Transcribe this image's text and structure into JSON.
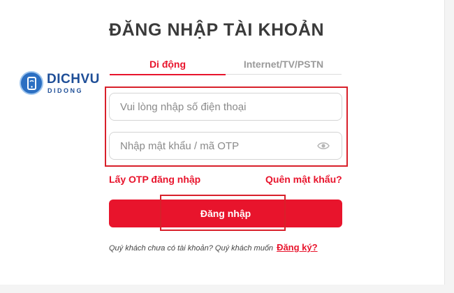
{
  "brand": {
    "logo_word": "DICHVU",
    "logo_sub": "DIDONG",
    "primary_color": "#e8142c",
    "logo_color": "#1e4e97"
  },
  "page": {
    "title": "ĐĂNG NHẬP TÀI KHOẢN"
  },
  "tabs": [
    {
      "label": "Di động",
      "active": true
    },
    {
      "label": "Internet/TV/PSTN",
      "active": false
    }
  ],
  "form": {
    "phone": {
      "value": "",
      "placeholder": "Vui lòng nhập số điện thoại"
    },
    "password": {
      "value": "",
      "placeholder": "Nhập mật khẩu / mã OTP",
      "toggle_icon": "eye-icon"
    }
  },
  "links": {
    "otp_login": "Lấy OTP đăng nhập",
    "forgot_password": "Quên mật khẩu?"
  },
  "actions": {
    "login_label": "Đăng nhập"
  },
  "register": {
    "prompt": "Quý khách chưa có tài khoản? Quý khách muốn",
    "link": "Đăng ký?"
  }
}
